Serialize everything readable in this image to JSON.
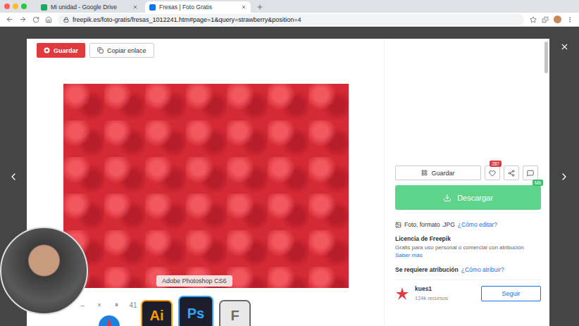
{
  "browser": {
    "tabs": [
      {
        "label": "Mi unidad - Google Drive",
        "selected": false,
        "color": "#1fa463"
      },
      {
        "label": "Fresas | Foto Gratis",
        "selected": true,
        "color": "#1273eb"
      }
    ],
    "address": "freepik.es/foto-gratis/fresas_1012241.htm#page=1&query=strawberry&position=4"
  },
  "modal": {
    "pin_button": "Guardar",
    "copy_button": "Copiar enlace",
    "save_button": "Guardar",
    "likes": "287",
    "download": "Descargar",
    "size_badge": "Mb",
    "format": "Foto, formato .JPG",
    "edit_link": "¿Cómo editar?",
    "license_title": "Licencia de Freepik",
    "license_text": "Gratis para uso personal o comercial con atribución",
    "more_link": "Saber más",
    "attribution": "Se requiere atribución",
    "attribution_link": "¿Cómo atribuir?",
    "author": {
      "name": "kues1",
      "resources": "124k recursos"
    },
    "follow": "Seguir"
  },
  "video_controls": [
    "–",
    "×",
    "⏸",
    "41"
  ],
  "dock": {
    "tooltip": "Adobe Photoshop CS6",
    "apps": [
      {
        "label": "Ai",
        "selected": false,
        "color": "#ff9a00"
      },
      {
        "label": "Ps",
        "selected": true,
        "color": "#31a8ff"
      },
      {
        "label": "F",
        "selected": false,
        "color": "#6b6b6b"
      }
    ]
  }
}
